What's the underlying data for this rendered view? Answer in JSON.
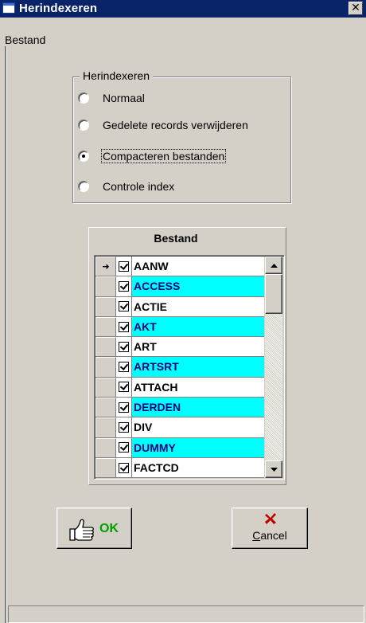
{
  "window": {
    "title": "Herindexeren",
    "close_label": "✕"
  },
  "menu": {
    "items": [
      "Bestand"
    ]
  },
  "group": {
    "legend": "Herindexeren",
    "options": [
      {
        "label": "Normaal",
        "checked": false
      },
      {
        "label": "Gedelete records verwijderen",
        "checked": false
      },
      {
        "label": "Compacteren bestanden",
        "checked": true
      },
      {
        "label": "Controle index",
        "checked": false
      }
    ]
  },
  "grid": {
    "caption": "Bestand",
    "current_row_indicator": "➜",
    "rows": [
      {
        "name": "AANW",
        "checked": true,
        "highlighted": false,
        "current": true
      },
      {
        "name": "ACCESS",
        "checked": true,
        "highlighted": true,
        "current": false
      },
      {
        "name": "ACTIE",
        "checked": true,
        "highlighted": false,
        "current": false
      },
      {
        "name": "AKT",
        "checked": true,
        "highlighted": true,
        "current": false
      },
      {
        "name": "ART",
        "checked": true,
        "highlighted": false,
        "current": false
      },
      {
        "name": "ARTSRT",
        "checked": true,
        "highlighted": true,
        "current": false
      },
      {
        "name": "ATTACH",
        "checked": true,
        "highlighted": false,
        "current": false
      },
      {
        "name": "DERDEN",
        "checked": true,
        "highlighted": true,
        "current": false
      },
      {
        "name": "DIV",
        "checked": true,
        "highlighted": false,
        "current": false
      },
      {
        "name": "DUMMY",
        "checked": true,
        "highlighted": true,
        "current": false
      },
      {
        "name": "FACTCD",
        "checked": true,
        "highlighted": false,
        "current": false
      }
    ]
  },
  "buttons": {
    "ok_label": "OK",
    "cancel_label_underlined": "C",
    "cancel_label_rest": "ancel"
  },
  "colors": {
    "title_bg": "#0a246a",
    "highlight_row": "#00ffff",
    "ok_green": "#00a000",
    "cancel_x_red": "#c00000"
  }
}
